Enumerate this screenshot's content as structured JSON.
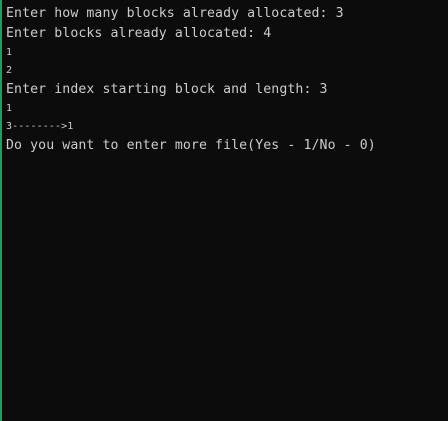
{
  "console": {
    "lines": [
      "Enter how many blocks already allocated: 3",
      "Enter blocks already allocated: 4",
      "1",
      "2",
      "Enter index starting block and length: 3",
      "1",
      "3-------->1",
      "Do you want to enter more file(Yes - 1/No - 0)"
    ]
  }
}
